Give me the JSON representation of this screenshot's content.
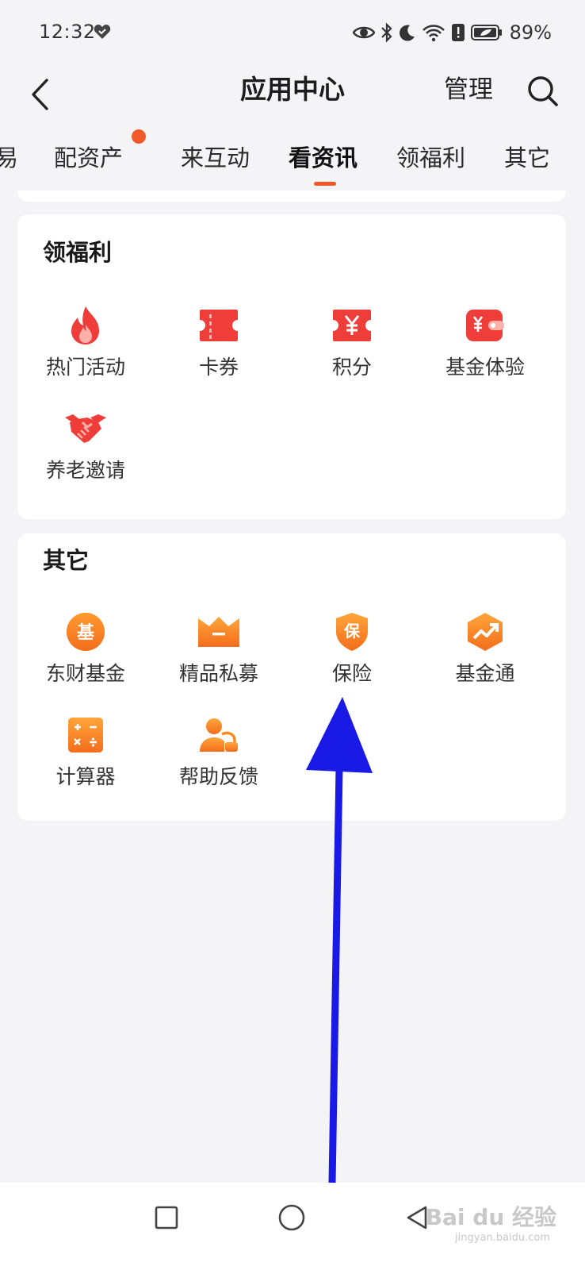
{
  "status_bar": {
    "time": "12:32",
    "battery": "89%"
  },
  "header": {
    "title": "应用中心",
    "manage_label": "管理"
  },
  "tabs": [
    {
      "label": "易",
      "active": false
    },
    {
      "label": "配资产",
      "active": false,
      "has_dot": true
    },
    {
      "label": "来互动",
      "active": false
    },
    {
      "label": "看资讯",
      "active": true
    },
    {
      "label": "领福利",
      "active": false
    },
    {
      "label": "其它",
      "active": false
    }
  ],
  "sections": {
    "welfare": {
      "title": "领福利",
      "items": [
        {
          "label": "热门活动",
          "icon": "flame-icon"
        },
        {
          "label": "卡券",
          "icon": "coupon-icon"
        },
        {
          "label": "积分",
          "icon": "points-ticket-icon"
        },
        {
          "label": "基金体验",
          "icon": "wallet-icon"
        },
        {
          "label": "养老邀请",
          "icon": "handshake-icon"
        }
      ]
    },
    "other": {
      "title": "其它",
      "items": [
        {
          "label": "东财基金",
          "icon": "fund-circle-icon",
          "glyph": "基"
        },
        {
          "label": "精品私募",
          "icon": "crown-icon"
        },
        {
          "label": "保险",
          "icon": "shield-icon",
          "glyph": "保"
        },
        {
          "label": "基金通",
          "icon": "trend-hexagon-icon"
        },
        {
          "label": "计算器",
          "icon": "calculator-icon"
        },
        {
          "label": "帮助反馈",
          "icon": "support-person-icon"
        }
      ]
    }
  },
  "watermark": {
    "brand": "Bai du 经验",
    "sub": "jingyan.baidu.com"
  },
  "colors": {
    "accent": "#f0582a",
    "icon_red": "#ef3e3a",
    "icon_orange": "#f78a1f",
    "arrow": "#1a1ae6"
  }
}
